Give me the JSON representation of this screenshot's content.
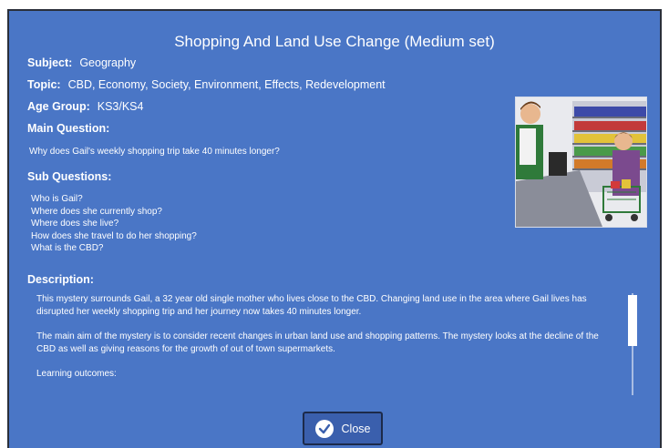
{
  "dialog": {
    "title": "Shopping And Land Use Change (Medium set)"
  },
  "subject": {
    "label": "Subject:",
    "value": "Geography"
  },
  "topic": {
    "label": "Topic:",
    "value": "CBD, Economy, Society, Environment, Effects, Redevelopment"
  },
  "age_group": {
    "label": "Age Group:",
    "value": "KS3/KS4"
  },
  "main_question": {
    "heading": "Main Question:",
    "text": "Why does Gail's weekly shopping trip take 40 minutes longer?"
  },
  "sub_questions": {
    "heading": "Sub Questions:",
    "items": [
      "Who is Gail?",
      "Where does she currently shop?",
      "Where does she live?",
      "How does she travel to do her shopping?",
      "What is the CBD?"
    ]
  },
  "description": {
    "heading": "Description:",
    "paragraphs": [
      "This mystery surrounds Gail, a 32 year old single mother who lives close to the CBD.  Changing land use in the area where Gail lives has disrupted her weekly shopping trip and her journey now takes 40 minutes longer.",
      "The main aim of the mystery is to consider recent changes in urban land use and shopping patterns. The mystery looks at the decline of the CBD as well as giving reasons for the growth of out of town supermarkets.",
      "Learning outcomes:"
    ]
  },
  "close_button": {
    "label": "Close",
    "icon": "check-icon"
  },
  "colors": {
    "background": "#4a76c6",
    "button": "#3a5fad"
  }
}
